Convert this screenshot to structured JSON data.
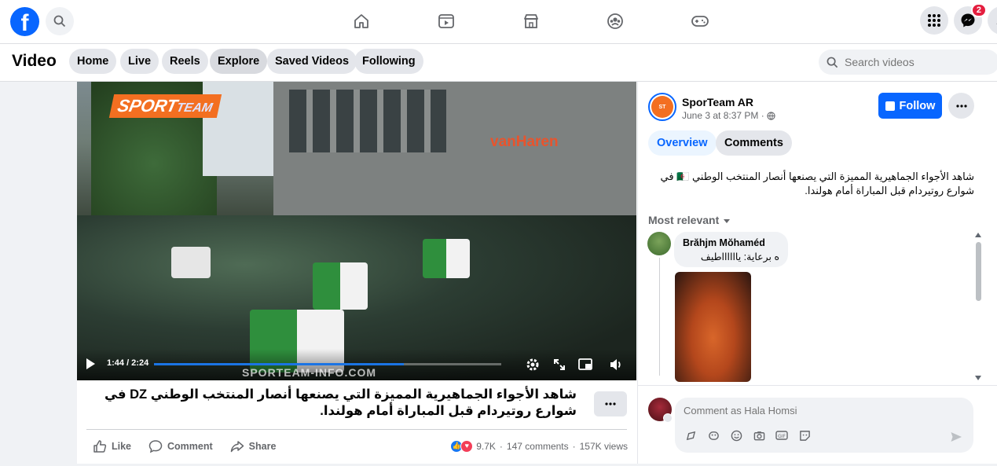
{
  "topbar": {
    "messenger_badge": "2",
    "nav_icons": [
      "home-icon",
      "video-icon",
      "marketplace-icon",
      "groups-icon",
      "gaming-icon"
    ]
  },
  "subnav": {
    "title": "Video",
    "tabs": [
      "Home",
      "Live",
      "Reels",
      "Explore",
      "Saved Videos",
      "Following"
    ],
    "active_tab": "Explore",
    "search_placeholder": "Search videos"
  },
  "player": {
    "logo_main": "SPORT",
    "logo_sub": "TEAM",
    "store_sign": "vanHaren",
    "time": "1:44 / 2:24",
    "progress": 0.72,
    "watermark": "SPORTEAM-INFO.COM"
  },
  "post": {
    "description": "شاهد الأجواء الجماهيرية المميزة التي يصنعها أنصار المنتخب الوطني DZ في شوارع روتيردام قبل المباراة أمام هولندا.",
    "actions": {
      "like": "Like",
      "comment": "Comment",
      "share": "Share"
    },
    "reactions": "9.7K",
    "comments": "147 comments",
    "views": "157K views"
  },
  "side": {
    "page_name": "SporTeam AR",
    "date": "June 3 at 8:37 PM ·",
    "follow": "Follow",
    "tabs": {
      "overview": "Overview",
      "comments": "Comments"
    },
    "text": "شاهد الأجواء الجماهيرية المميزة التي يصنعها أنصار المنتخب الوطني 🇩🇿 في شوارع روتيردام قبل المباراة أمام هولندا.",
    "sort": "Most relevant",
    "comment": {
      "name": "Brăhjm Mŏhaméd",
      "text": "ه برعاية: يااااااطيف"
    },
    "comment_placeholder": "Comment as Hala Homsi"
  },
  "colors": {
    "accent": "#0866ff",
    "brand_orange": "#f36f21",
    "badge_red": "#e41e3f"
  }
}
